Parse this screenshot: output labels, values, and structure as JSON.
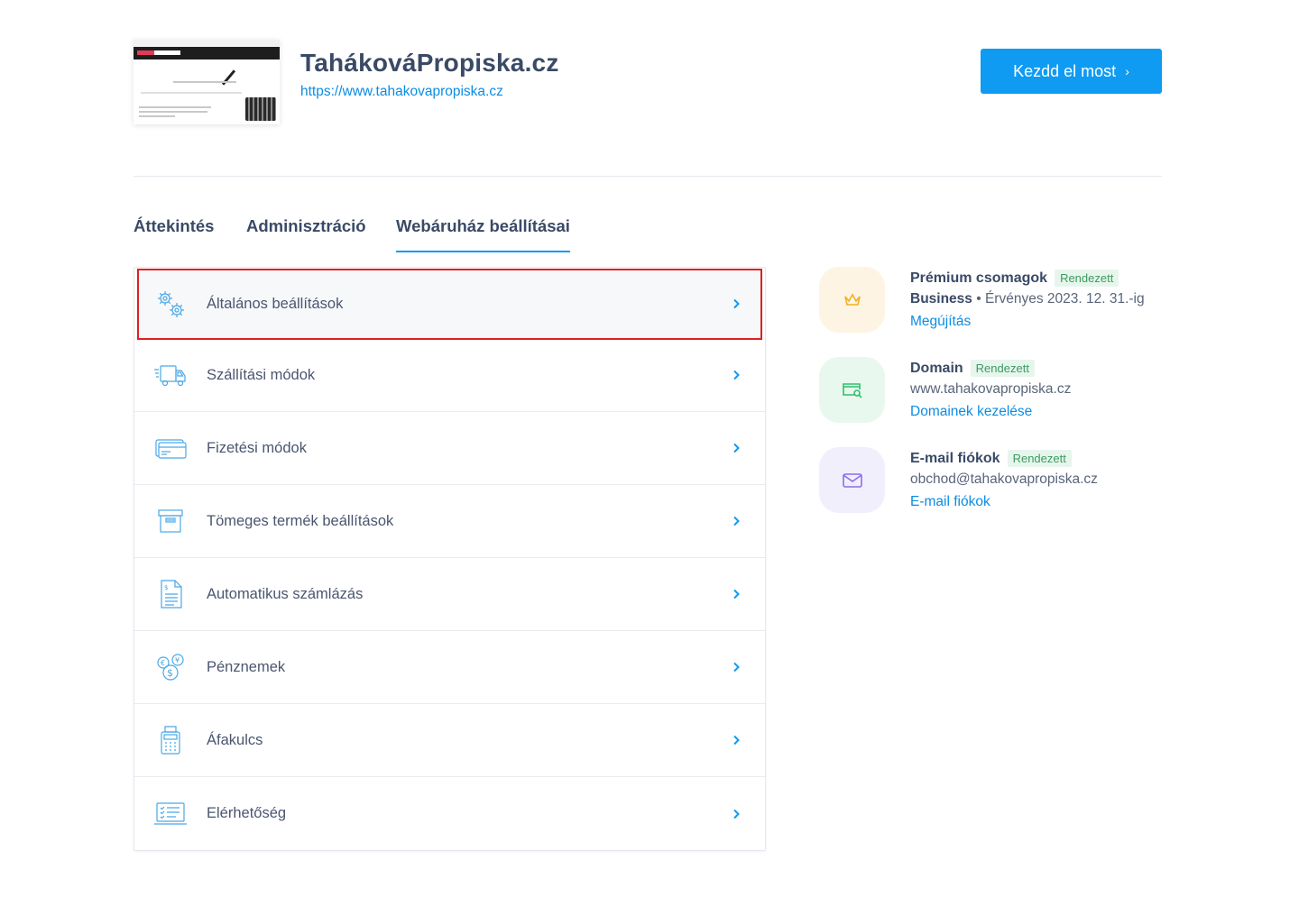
{
  "header": {
    "site_title": "TahákováPropiska.cz",
    "site_url": "https://www.tahakovapropiska.cz",
    "cta_label": "Kezdd el most",
    "thumbnail": {
      "lines": [
        "Vysvětly opouštění akce a t a ml",
        "Malá unikátní tahaková propiska je vhodný a hlavně nenápadný pomocník, který vás nenecha v nesnázích."
      ]
    }
  },
  "tabs": [
    {
      "label": "Áttekintés",
      "active": false
    },
    {
      "label": "Adminisztráció",
      "active": false
    },
    {
      "label": "Webáruház beállításai",
      "active": true
    }
  ],
  "settings": [
    {
      "label": "Általános beállítások",
      "icon": "gears-icon",
      "highlighted": true
    },
    {
      "label": "Szállítási módok",
      "icon": "truck-icon"
    },
    {
      "label": "Fizetési módok",
      "icon": "credit-card-icon"
    },
    {
      "label": "Tömeges termék beállítások",
      "icon": "archive-box-icon"
    },
    {
      "label": "Automatikus számlázás",
      "icon": "invoice-icon"
    },
    {
      "label": "Pénznemek",
      "icon": "currency-coins-icon"
    },
    {
      "label": "Áfakulcs",
      "icon": "calculator-icon"
    },
    {
      "label": "Elérhetőség",
      "icon": "laptop-checklist-icon"
    }
  ],
  "info": {
    "premium": {
      "title": "Prémium csomagok",
      "badge": "Rendezett",
      "plan": "Business",
      "validity": "• Érvényes 2023. 12. 31.-ig",
      "link": "Megújítás",
      "icon": "crown-icon",
      "color": "#f2b01e"
    },
    "domain": {
      "title": "Domain",
      "badge": "Rendezett",
      "value": "www.tahakovapropiska.cz",
      "link": "Domainek kezelése",
      "icon": "domain-search-icon",
      "color": "#2fbf6a"
    },
    "email": {
      "title": "E-mail fiókok",
      "badge": "Rendezett",
      "value": "obchod@tahakovapropiska.cz",
      "link": "E-mail fiókok",
      "icon": "envelope-icon",
      "color": "#8a6ee8"
    }
  },
  "colors": {
    "accent": "#0f9bf2",
    "highlight_border": "#e02020",
    "badge_text": "#3c9a62"
  }
}
